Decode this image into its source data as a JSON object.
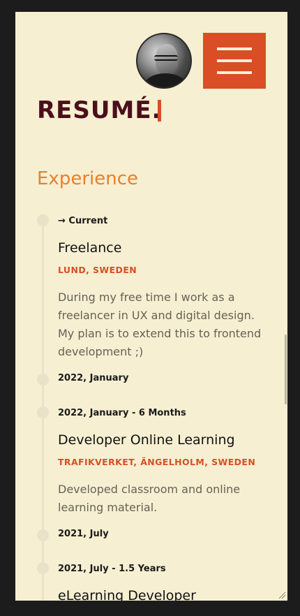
{
  "header": {
    "title": "RESUMÉ.",
    "menu_icon": "hamburger-icon",
    "avatar_icon": "profile-photo"
  },
  "experience": {
    "heading": "Experience",
    "entries": [
      {
        "start": "→ Current",
        "title": "Freelance",
        "location": "LUND, SWEDEN",
        "description": "During my free time I work as a freelancer in UX and digital design. My plan is to extend this to frontend development ;)",
        "end": "2022, January"
      },
      {
        "start": "2022, January - 6 Months",
        "title": "Developer Online Learning",
        "location": "TRAFIKVERKET, ÄNGELHOLM, SWEDEN",
        "description": "Developed classroom and online learning material.",
        "end": "2021, July"
      },
      {
        "start": "2021, July - 1.5 Years",
        "title": "eLearning Developer"
      }
    ]
  },
  "colors": {
    "background": "#f6efd2",
    "accent": "#d94e24",
    "title": "#4b0f1c",
    "section": "#e87f2e"
  }
}
